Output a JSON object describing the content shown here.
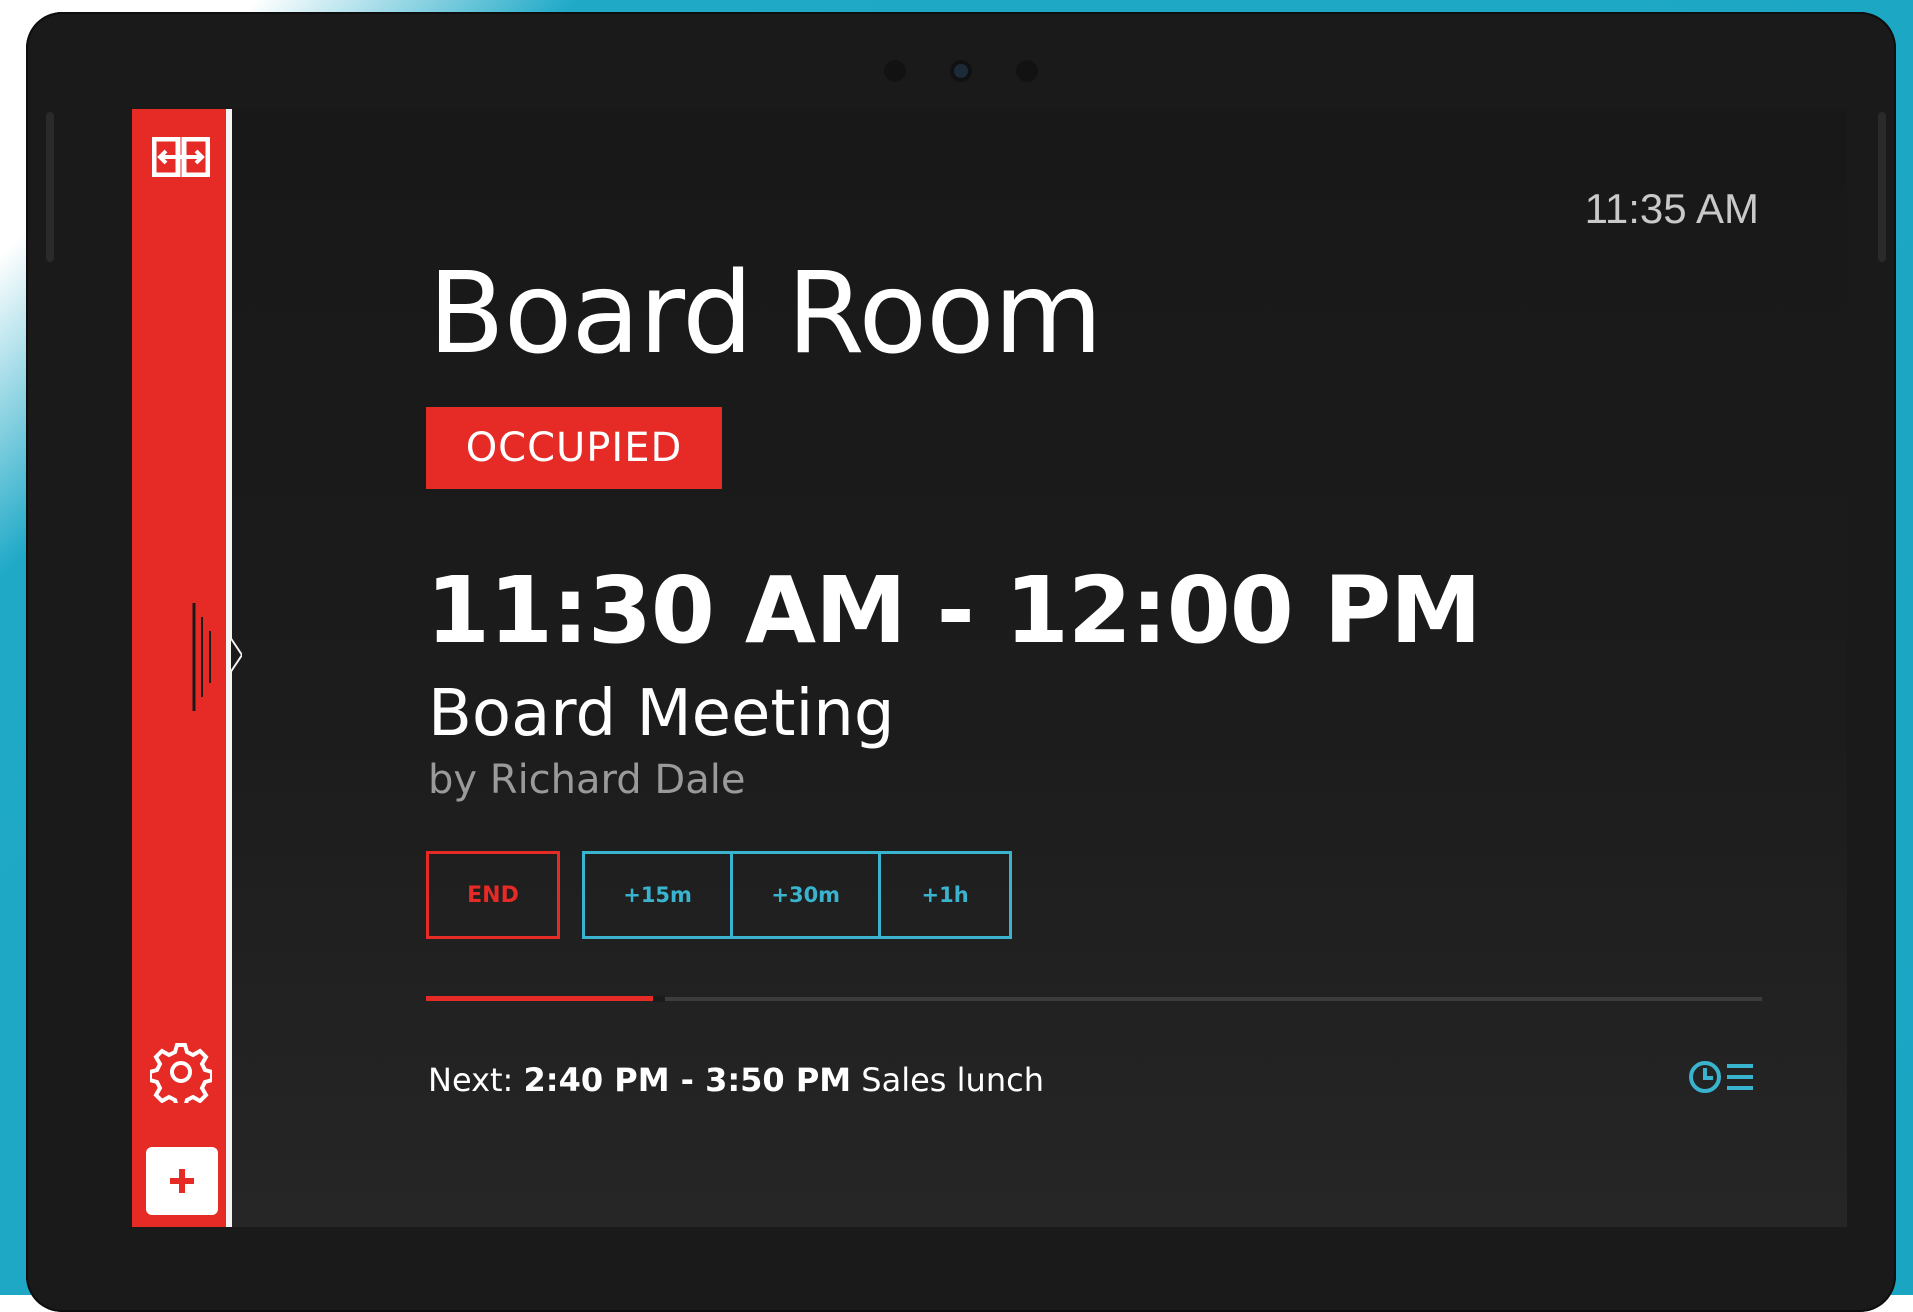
{
  "clock": "11:35 AM",
  "room": {
    "name": "Board Room",
    "status": "OCCUPIED"
  },
  "meeting": {
    "time": "11:30 AM - 12:00 PM",
    "title": "Board Meeting",
    "organizer": "by Richard Dale",
    "progress_percent": 17
  },
  "actions": {
    "end_label": "END",
    "extend": [
      "+15m",
      "+30m",
      "+1h"
    ]
  },
  "next": {
    "prefix": "Next:",
    "time": "2:40 PM - 3:50 PM",
    "title": "Sales lunch"
  },
  "icons": {
    "logo": "room-panel-logo-icon",
    "settings": "gear-icon",
    "add": "plus-icon",
    "schedule": "schedule-list-icon"
  },
  "colors": {
    "accent_red": "#e62a26",
    "accent_teal": "#3ab3cf",
    "background": "#1a1a1a"
  }
}
